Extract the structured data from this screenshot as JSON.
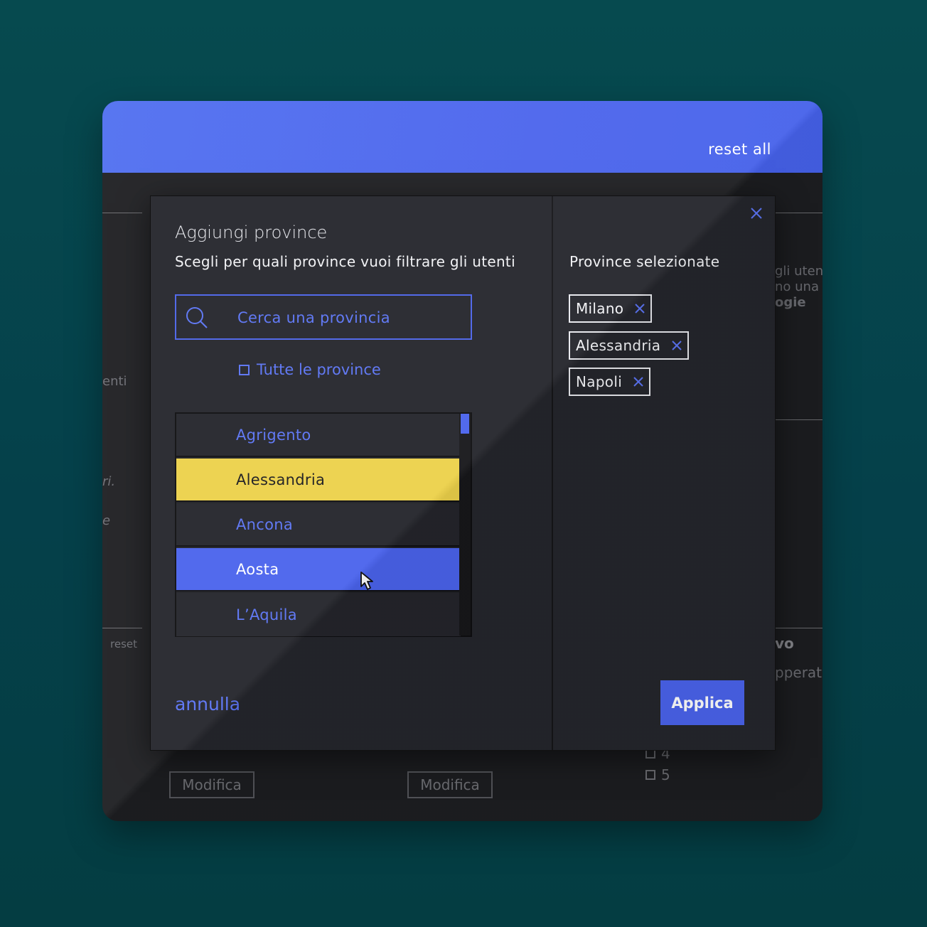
{
  "header": {
    "reset_all": "reset all"
  },
  "background": {
    "right_text_1": "gli uten",
    "right_text_2": "no una",
    "right_text_3": "ogie",
    "left_text_1": "enti",
    "left_text_2": "ri.",
    "left_text_3": "e",
    "left_reset": "reset",
    "right_heading": "vo",
    "right_text_4": "pperat",
    "modifica_1": "Modifica",
    "modifica_2": "Modifica",
    "rating_4": "4",
    "rating_5": "5"
  },
  "modal": {
    "title": "Aggiungi province",
    "subtitle": "Scegli per quali province vuoi filtrare gli utenti",
    "search_placeholder": "Cerca una provincia",
    "all_provinces_label": "Tutte le province",
    "list": [
      {
        "name": "Agrigento",
        "state": "normal"
      },
      {
        "name": "Alessandria",
        "state": "highlighted"
      },
      {
        "name": "Ancona",
        "state": "normal"
      },
      {
        "name": "Aosta",
        "state": "hovered"
      },
      {
        "name": "L’Aquila",
        "state": "normal"
      }
    ],
    "cancel_label": "annulla",
    "selected_title": "Province selezionate",
    "selected": [
      "Milano",
      "Alessandria",
      "Napoli"
    ],
    "apply_label": "Applica"
  },
  "icons": {
    "search": "search-icon",
    "close": "close-icon",
    "remove_chip": "close-icon",
    "checkbox": "checkbox-icon",
    "cursor": "mouse-cursor-icon"
  },
  "colors": {
    "accent": "#4a63ec",
    "highlight": "#ecd14a",
    "modal_bg": "#25262c",
    "page_bg": "#064a4f"
  }
}
